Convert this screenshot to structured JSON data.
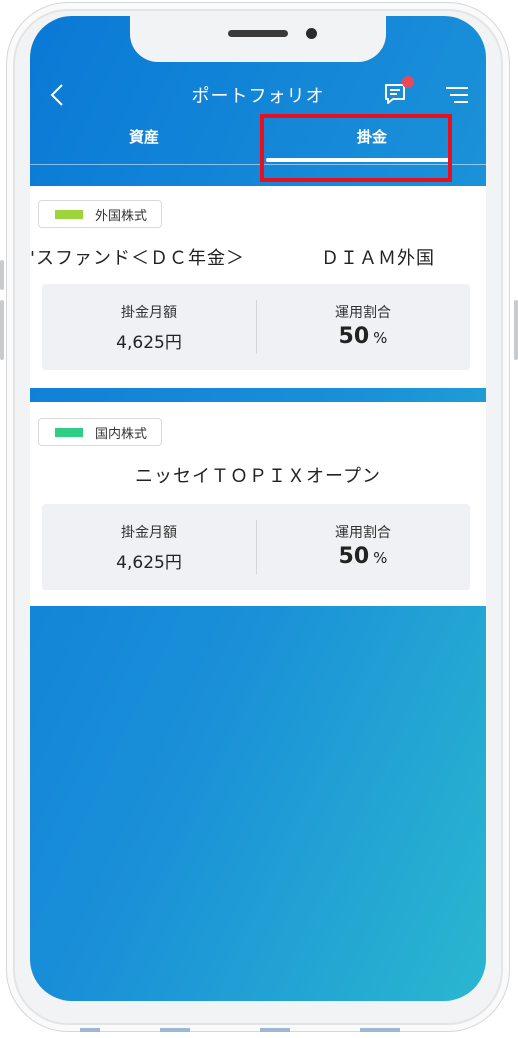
{
  "header": {
    "title": "ポートフォリオ"
  },
  "tabs": [
    {
      "label": "資産"
    },
    {
      "label": "掛金"
    }
  ],
  "cards": [
    {
      "category": "外国株式",
      "category_color": "#9bd53b",
      "fund_name": "'スファンド＜ＤＣ年金＞　　　　ＤＩＡＭ外国",
      "monthly_label": "掛金月額",
      "monthly_value": "4,625円",
      "ratio_label": "運用割合",
      "ratio_value": "50",
      "ratio_unit": "%"
    },
    {
      "category": "国内株式",
      "category_color": "#2fce84",
      "fund_name": "ニッセイＴＯＰＩＸオープン",
      "monthly_label": "掛金月額",
      "monthly_value": "4,625円",
      "ratio_label": "運用割合",
      "ratio_value": "50",
      "ratio_unit": "%"
    }
  ],
  "colors": {
    "brand_gradient_start": "#0a79d6",
    "brand_gradient_end": "#2ab7cf",
    "highlight": "#e8101e",
    "notification_dot": "#e8485a"
  },
  "icons": {
    "back": "chevron-left-icon",
    "messages": "message-icon",
    "menu": "menu-icon"
  }
}
